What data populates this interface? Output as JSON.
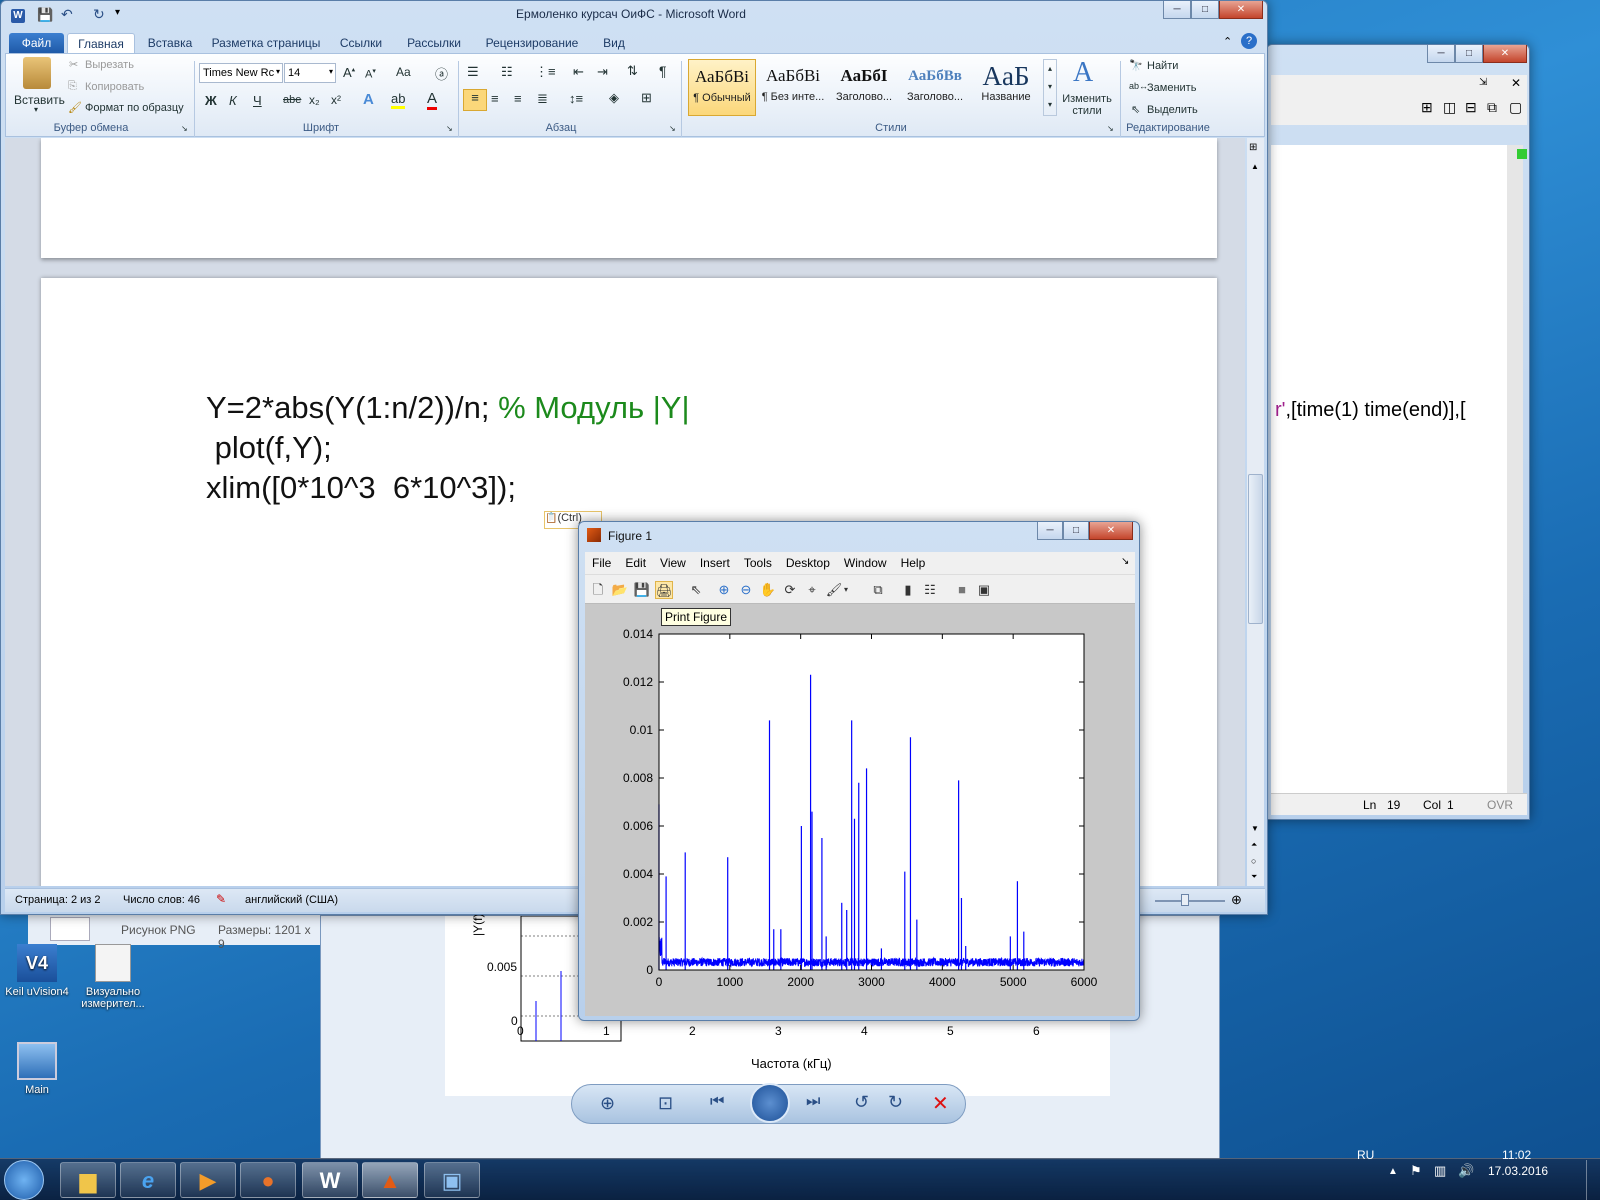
{
  "word": {
    "title": "Ермоленко курсач ОиФС - Microsoft Word",
    "file_tab": "Файл",
    "tabs": [
      "Главная",
      "Вставка",
      "Разметка страницы",
      "Ссылки",
      "Рассылки",
      "Рецензирование",
      "Вид"
    ],
    "clipboard": {
      "paste": "Вставить",
      "cut": "Вырезать",
      "copy": "Копировать",
      "format_painter": "Формат по образцу",
      "group": "Буфер обмена"
    },
    "font": {
      "name": "Times New Rc",
      "size": "14",
      "group": "Шрифт",
      "bold": "Ж",
      "italic": "К",
      "underline": "Ч",
      "strike": "abe",
      "sub": "x₂",
      "sup": "x²",
      "case": "Aa"
    },
    "paragraph": {
      "group": "Абзац"
    },
    "styles": {
      "group": "Стили",
      "items": [
        {
          "preview": "АаБбВі",
          "label": "¶ Обычный"
        },
        {
          "preview": "АаБбВі",
          "label": "¶ Без инте..."
        },
        {
          "preview": "АаБбІ",
          "label": "Заголово..."
        },
        {
          "preview": "АаБбВв",
          "label": "Заголово..."
        },
        {
          "preview": "AaБ",
          "label": "Название"
        }
      ],
      "change": "Изменить стили"
    },
    "editing": {
      "find": "Найти",
      "replace": "Заменить",
      "select": "Выделить",
      "group": "Редактирование"
    },
    "doc_lines": [
      "Y=2*abs(Y(1:n/2))/n;",
      "% Модуль |Y|",
      " plot(f,Y);",
      "xlim([0*10^3  6*10^3]);"
    ],
    "paste_tag": "(Ctrl)",
    "status": {
      "page": "Страница: 2 из 2",
      "words": "Число слов: 46",
      "lang": "английский (США)"
    }
  },
  "editor": {
    "code_fragment_purple": "r'",
    "code_fragment": ",[time(1) time(end)],[",
    "ln_label": "Ln",
    "ln": "19",
    "col_label": "Col",
    "col": "1",
    "ovr": "OVR"
  },
  "photo_viewer": {
    "file_type": "Рисунок PNG",
    "dims": "Размеры: 1201 x 9",
    "ylabel": "|Y(f)|",
    "y_tick": "0.005",
    "y_zero": "0",
    "x_ticks": [
      "0",
      "1",
      "2",
      "3",
      "4",
      "5",
      "6"
    ],
    "xlabel": "Частота (кГц)"
  },
  "figure": {
    "title": "Figure 1",
    "menu": [
      "File",
      "Edit",
      "View",
      "Insert",
      "Tools",
      "Desktop",
      "Window",
      "Help"
    ],
    "tooltip": "Print Figure"
  },
  "chart_data": {
    "type": "line",
    "title": "",
    "xlabel": "",
    "ylabel": "",
    "xlim": [
      0,
      6000
    ],
    "ylim": [
      0,
      0.014
    ],
    "x_ticks": [
      "0",
      "1000",
      "2000",
      "3000",
      "4000",
      "5000",
      "6000"
    ],
    "y_ticks": [
      "0",
      "0.002",
      "0.004",
      "0.006",
      "0.008",
      "0.01",
      "0.012",
      "0.014"
    ],
    "series": [
      {
        "color": "#0000ff",
        "peaks": [
          {
            "x": 0,
            "y": 0.0069
          },
          {
            "x": 100,
            "y": 0.0039
          },
          {
            "x": 370,
            "y": 0.0049
          },
          {
            "x": 970,
            "y": 0.0047
          },
          {
            "x": 1560,
            "y": 0.0104
          },
          {
            "x": 1620,
            "y": 0.0017
          },
          {
            "x": 1720,
            "y": 0.0017
          },
          {
            "x": 2010,
            "y": 0.006
          },
          {
            "x": 2140,
            "y": 0.0123
          },
          {
            "x": 2160,
            "y": 0.0066
          },
          {
            "x": 2300,
            "y": 0.0055
          },
          {
            "x": 2360,
            "y": 0.0014
          },
          {
            "x": 2580,
            "y": 0.0028
          },
          {
            "x": 2650,
            "y": 0.0025
          },
          {
            "x": 2720,
            "y": 0.0104
          },
          {
            "x": 2760,
            "y": 0.0063
          },
          {
            "x": 2820,
            "y": 0.0078
          },
          {
            "x": 2930,
            "y": 0.0084
          },
          {
            "x": 3140,
            "y": 0.0009
          },
          {
            "x": 3470,
            "y": 0.0041
          },
          {
            "x": 3550,
            "y": 0.0097
          },
          {
            "x": 3640,
            "y": 0.0021
          },
          {
            "x": 4230,
            "y": 0.0079
          },
          {
            "x": 4270,
            "y": 0.003
          },
          {
            "x": 4330,
            "y": 0.001
          },
          {
            "x": 4960,
            "y": 0.0014
          },
          {
            "x": 5060,
            "y": 0.0037
          },
          {
            "x": 5150,
            "y": 0.0016
          }
        ]
      }
    ]
  },
  "desktop_icons": [
    "Keil uVision4",
    "Визуально измерител...",
    "Main"
  ],
  "viewer_controls": [
    "zoom",
    "fit",
    "prev",
    "slideshow",
    "next",
    "rotate-left",
    "rotate-right",
    "delete"
  ],
  "tray": {
    "lang": "RU",
    "time": "11:02",
    "date": "17.03.2016"
  }
}
